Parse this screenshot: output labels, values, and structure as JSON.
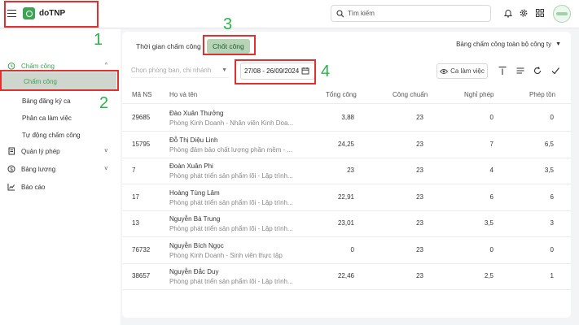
{
  "app": {
    "name": "doTNP"
  },
  "search": {
    "placeholder": "Tìm kiếm"
  },
  "sidebar": {
    "groups": [
      {
        "label": "Chấm công",
        "icon": "clock-icon",
        "expanded": true
      },
      {
        "label": "Quản lý phép",
        "icon": "document-icon",
        "expanded": false
      },
      {
        "label": "Bảng lương",
        "icon": "dollar-icon",
        "expanded": false
      },
      {
        "label": "Báo cáo",
        "icon": "chart-icon"
      }
    ],
    "subitems": [
      "Chấm công",
      "Bảng đăng ký ca",
      "Phân ca làm việc",
      "Tự động chấm công"
    ]
  },
  "tabs": {
    "time": "Thời gian chấm công",
    "close": "Chốt công"
  },
  "company_select": "Bảng chấm công toàn bộ công ty",
  "filters": {
    "dept_placeholder": "Chọn phòng ban, chi nhánh",
    "date_range": "27/08 - 26/09/2024",
    "shift_button": "Ca làm việc"
  },
  "table": {
    "headers": [
      "Mã NS",
      "Họ và tên",
      "Tổng công",
      "Công chuẩn",
      "Nghỉ phép",
      "Phép tồn"
    ],
    "rows": [
      {
        "id": "29685",
        "name": "Đào Xuân Thưởng",
        "dept": "Phòng Kinh Doanh - Nhân viên Kinh Doa...",
        "total": "3,88",
        "standard": "23",
        "leave": "0",
        "remain": "0"
      },
      {
        "id": "15795",
        "name": "Đỗ Thị Diệu Linh",
        "dept": "Phòng đảm bảo chất lượng phần mềm - ...",
        "total": "24,25",
        "standard": "23",
        "leave": "7",
        "remain": "6,5"
      },
      {
        "id": "7",
        "name": "Đoàn Xuân Phi",
        "dept": "Phòng phát triển sản phẩm lõi - Lập trình...",
        "total": "23",
        "standard": "23",
        "leave": "4",
        "remain": "3,5"
      },
      {
        "id": "17",
        "name": "Hoàng Tùng Lâm",
        "dept": "Phòng phát triển sản phẩm lõi - Lập trình...",
        "total": "22,91",
        "standard": "23",
        "leave": "6",
        "remain": "6"
      },
      {
        "id": "13",
        "name": "Nguyễn Bá Trung",
        "dept": "Phòng phát triển sản phẩm lõi - Lập trình...",
        "total": "23,01",
        "standard": "23",
        "leave": "3,5",
        "remain": "3"
      },
      {
        "id": "76732",
        "name": "Nguyễn Bích Ngọc",
        "dept": "Phòng Kinh Doanh - Sinh viên thực tập",
        "total": "0",
        "standard": "23",
        "leave": "0",
        "remain": "0"
      },
      {
        "id": "38657",
        "name": "Nguyễn Đắc Duy",
        "dept": "Phòng phát triển sản phẩm lõi - Lập trình...",
        "total": "22,46",
        "standard": "23",
        "leave": "2,5",
        "remain": "1"
      }
    ]
  },
  "annotations": [
    "1",
    "2",
    "3",
    "4"
  ],
  "colors": {
    "brand": "#3ea454",
    "annotation_box": "#e03030",
    "annotation_number": "#2ab34a",
    "active_subitem_bg": "#cfd6cd",
    "active_tab_bg": "#b7d3b8"
  }
}
